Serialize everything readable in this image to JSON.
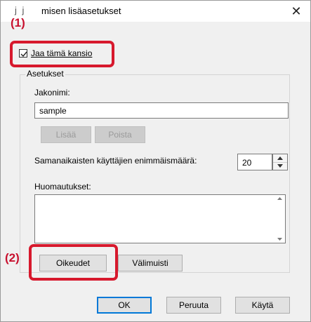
{
  "window": {
    "title_prefix": "j j",
    "title": "misen lisäasetukset",
    "close_glyph": "✕"
  },
  "callouts": {
    "c1": "(1)",
    "c2": "(2)",
    "highlight_color": "#d7192d"
  },
  "share_checkbox": {
    "label": "Jaa tämä kansio",
    "checked": true
  },
  "settings": {
    "legend": "Asetukset",
    "share_name_label": "Jakonimi:",
    "share_name_value": "sample",
    "add_button": "Lisää",
    "remove_button": "Poista",
    "max_users_label": "Samanaikaisten käyttäjien enimmäismäärä:",
    "max_users_value": "20",
    "notes_label": "Huomautukset:",
    "notes_value": "",
    "permissions_button": "Oikeudet",
    "cache_button": "Välimuisti"
  },
  "footer": {
    "ok_button": "OK",
    "cancel_button": "Peruuta",
    "apply_button": "Käytä"
  }
}
